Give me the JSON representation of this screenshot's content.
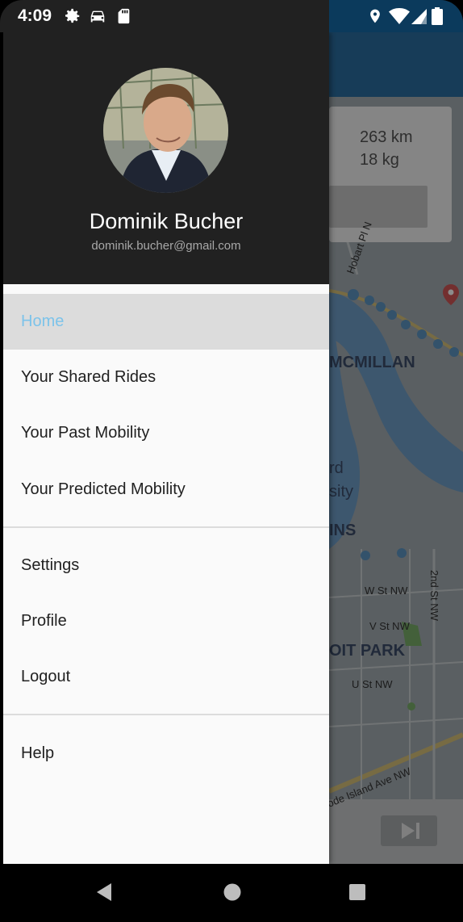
{
  "status_bar": {
    "time": "4:09",
    "icons_left": [
      "gear-icon",
      "car-icon",
      "sd-card-icon"
    ],
    "icons_right": [
      "location-icon",
      "wifi-icon",
      "signal-icon",
      "battery-icon"
    ]
  },
  "user": {
    "name": "Dominik Bucher",
    "email": "dominik.bucher@gmail.com"
  },
  "menu": {
    "home": "Home",
    "shared_rides": "Your Shared Rides",
    "past_mobility": "Your Past Mobility",
    "predicted_mobility": "Your Predicted Mobility",
    "settings": "Settings",
    "profile": "Profile",
    "logout": "Logout",
    "help": "Help"
  },
  "map": {
    "distance": "263 km",
    "co2": "18 kg",
    "labels": [
      "Hobart Pl N",
      "MCMILLAN",
      "rd",
      "sity",
      "INS",
      "W St NW",
      "2nd St NW",
      "V St NW",
      "OIT PARK",
      "U St NW",
      "ode Island Ave NW",
      "St NW"
    ]
  },
  "colors": {
    "drawer_header": "#212121",
    "active_text": "#7cc3ea",
    "active_bg": "#dcdcdc"
  }
}
